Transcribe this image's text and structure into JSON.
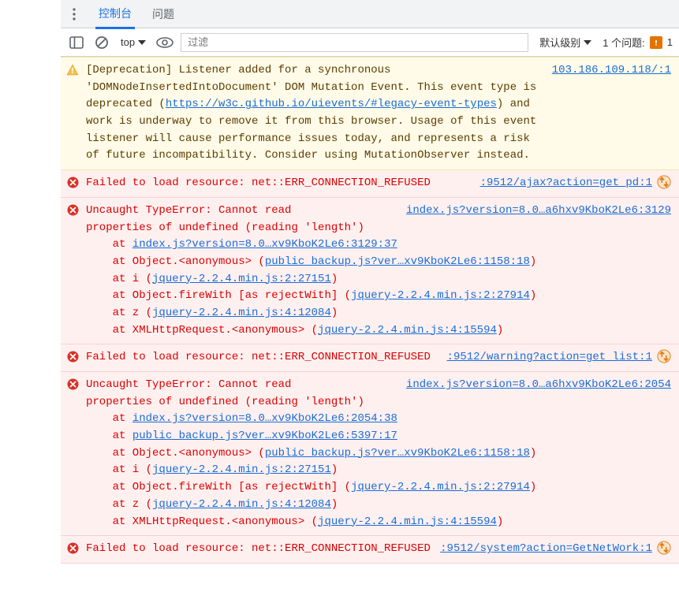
{
  "tabs": {
    "console": "控制台",
    "issues": "问题"
  },
  "toolbar": {
    "context": "top",
    "filter_placeholder": "过滤",
    "level": "默认级别",
    "issue_label": "1 个问题:",
    "issue_count": "1"
  },
  "logs": [
    {
      "type": "warn",
      "source": "103.186.109.118/:1",
      "text_a": "[Deprecation] Listener added for a synchronous 'DOMNodeInsertedIntoDocument' DOM Mutation Event. This event type is deprecated (",
      "link": "https://w3c.github.io/uievents/#legacy-event-types",
      "text_b": ") and work is underway to remove it from this browser. Usage of this event listener will cause performance issues today, and represents a risk of future incompatibility. Consider using MutationObserver instead."
    },
    {
      "type": "error",
      "source": ":9512/ajax?action=get_pd:1",
      "ajax": true,
      "text": "Failed to load resource: net::ERR_CONNECTION_REFUSED"
    },
    {
      "type": "error",
      "source": "index.js?version=8.0…a6hxv9KboK2Le6:3129",
      "head_a": "Uncaught TypeError: Cannot read",
      "head_b": "properties of undefined (reading 'length')",
      "stack": [
        {
          "pre": "at ",
          "link": "index.js?version=8.0…xv9KboK2Le6:3129:37",
          "post": ""
        },
        {
          "pre": "at Object.<anonymous> (",
          "link": "public_backup.js?ver…xv9KboK2Le6:1158:18",
          "post": ")"
        },
        {
          "pre": "at i (",
          "link": "jquery-2.2.4.min.js:2:27151",
          "post": ")"
        },
        {
          "pre": "at Object.fireWith [as rejectWith] (",
          "link": "jquery-2.2.4.min.js:2:27914",
          "post": ")"
        },
        {
          "pre": "at z (",
          "link": "jquery-2.2.4.min.js:4:12084",
          "post": ")"
        },
        {
          "pre": "at XMLHttpRequest.<anonymous> (",
          "link": "jquery-2.2.4.min.js:4:15594",
          "post": ")"
        }
      ]
    },
    {
      "type": "error",
      "source": ":9512/warning?action=get_list:1",
      "ajax": true,
      "text": "Failed to load resource: net::ERR_CONNECTION_REFUSED"
    },
    {
      "type": "error",
      "source": "index.js?version=8.0…a6hxv9KboK2Le6:2054",
      "head_a": "Uncaught TypeError: Cannot read",
      "head_b": "properties of undefined (reading 'length')",
      "stack": [
        {
          "pre": "at ",
          "link": "index.js?version=8.0…xv9KboK2Le6:2054:38",
          "post": ""
        },
        {
          "pre": "at ",
          "link": "public_backup.js?ver…xv9KboK2Le6:5397:17",
          "post": ""
        },
        {
          "pre": "at Object.<anonymous> (",
          "link": "public_backup.js?ver…xv9KboK2Le6:1158:18",
          "post": ")"
        },
        {
          "pre": "at i (",
          "link": "jquery-2.2.4.min.js:2:27151",
          "post": ")"
        },
        {
          "pre": "at Object.fireWith [as rejectWith] (",
          "link": "jquery-2.2.4.min.js:2:27914",
          "post": ")"
        },
        {
          "pre": "at z (",
          "link": "jquery-2.2.4.min.js:4:12084",
          "post": ")"
        },
        {
          "pre": "at XMLHttpRequest.<anonymous> (",
          "link": "jquery-2.2.4.min.js:4:15594",
          "post": ")"
        }
      ]
    },
    {
      "type": "error",
      "source": ":9512/system?action=GetNetWork:1",
      "ajax": true,
      "text": "Failed to load resource: net::ERR_CONNECTION_REFUSED"
    }
  ]
}
